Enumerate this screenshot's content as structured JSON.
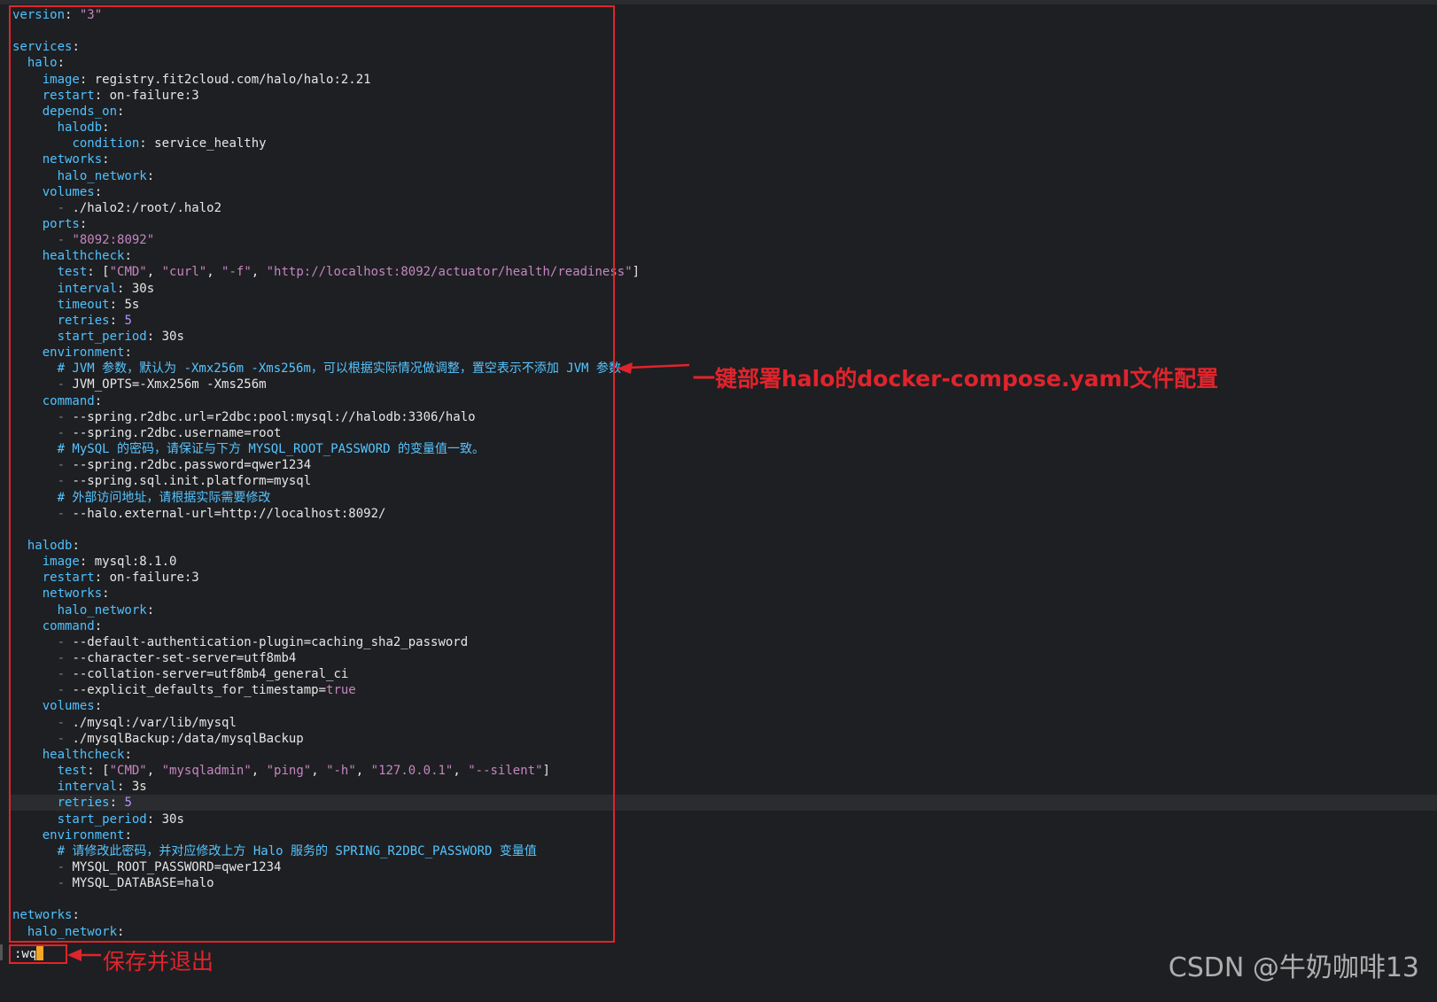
{
  "editor": {
    "lines": [
      [
        {
          "t": "version",
          "c": "k"
        },
        {
          "t": ": ",
          "c": "v"
        },
        {
          "t": "\"3\"",
          "c": "s"
        }
      ],
      [],
      [
        {
          "t": "services",
          "c": "k"
        },
        {
          "t": ":",
          "c": "v"
        }
      ],
      [
        {
          "t": "  "
        },
        {
          "t": "halo",
          "c": "k"
        },
        {
          "t": ":",
          "c": "v"
        }
      ],
      [
        {
          "t": "    "
        },
        {
          "t": "image",
          "c": "k"
        },
        {
          "t": ": registry.fit2cloud.com/halo/halo:2.21",
          "c": "v"
        }
      ],
      [
        {
          "t": "    "
        },
        {
          "t": "restart",
          "c": "k"
        },
        {
          "t": ": on-failure:3",
          "c": "v"
        }
      ],
      [
        {
          "t": "    "
        },
        {
          "t": "depends_on",
          "c": "k"
        },
        {
          "t": ":",
          "c": "v"
        }
      ],
      [
        {
          "t": "      "
        },
        {
          "t": "halodb",
          "c": "k"
        },
        {
          "t": ":",
          "c": "v"
        }
      ],
      [
        {
          "t": "        "
        },
        {
          "t": "condition",
          "c": "k"
        },
        {
          "t": ": service_healthy",
          "c": "v"
        }
      ],
      [
        {
          "t": "    "
        },
        {
          "t": "networks",
          "c": "k"
        },
        {
          "t": ":",
          "c": "v"
        }
      ],
      [
        {
          "t": "      "
        },
        {
          "t": "halo_network",
          "c": "k"
        },
        {
          "t": ":",
          "c": "v"
        }
      ],
      [
        {
          "t": "    "
        },
        {
          "t": "volumes",
          "c": "k"
        },
        {
          "t": ":",
          "c": "v"
        }
      ],
      [
        {
          "t": "      "
        },
        {
          "t": "- ",
          "c": "dash"
        },
        {
          "t": "./halo2:/root/.halo2",
          "c": "v"
        }
      ],
      [
        {
          "t": "    "
        },
        {
          "t": "ports",
          "c": "k"
        },
        {
          "t": ":",
          "c": "v"
        }
      ],
      [
        {
          "t": "      "
        },
        {
          "t": "- ",
          "c": "dash"
        },
        {
          "t": "\"8092:8092\"",
          "c": "s"
        }
      ],
      [
        {
          "t": "    "
        },
        {
          "t": "healthcheck",
          "c": "k"
        },
        {
          "t": ":",
          "c": "v"
        }
      ],
      [
        {
          "t": "      "
        },
        {
          "t": "test",
          "c": "k"
        },
        {
          "t": ": [",
          "c": "v"
        },
        {
          "t": "\"CMD\"",
          "c": "s"
        },
        {
          "t": ", ",
          "c": "v"
        },
        {
          "t": "\"curl\"",
          "c": "s"
        },
        {
          "t": ", ",
          "c": "v"
        },
        {
          "t": "\"-f\"",
          "c": "s"
        },
        {
          "t": ", ",
          "c": "v"
        },
        {
          "t": "\"http://localhost:8092/actuator/health/readiness\"",
          "c": "s"
        },
        {
          "t": "]",
          "c": "v"
        }
      ],
      [
        {
          "t": "      "
        },
        {
          "t": "interval",
          "c": "k"
        },
        {
          "t": ": 30s",
          "c": "v"
        }
      ],
      [
        {
          "t": "      "
        },
        {
          "t": "timeout",
          "c": "k"
        },
        {
          "t": ": 5s",
          "c": "v"
        }
      ],
      [
        {
          "t": "      "
        },
        {
          "t": "retries",
          "c": "k"
        },
        {
          "t": ": ",
          "c": "v"
        },
        {
          "t": "5",
          "c": "num"
        }
      ],
      [
        {
          "t": "      "
        },
        {
          "t": "start_period",
          "c": "k"
        },
        {
          "t": ": 30s",
          "c": "v"
        }
      ],
      [
        {
          "t": "    "
        },
        {
          "t": "environment",
          "c": "k"
        },
        {
          "t": ":",
          "c": "v"
        }
      ],
      [
        {
          "t": "      "
        },
        {
          "t": "# JVM 参数，默认为 -Xmx256m -Xms256m，可以根据实际情况做调整，置空表示不添加 JVM 参数",
          "c": "c"
        }
      ],
      [
        {
          "t": "      "
        },
        {
          "t": "- ",
          "c": "dash"
        },
        {
          "t": "JVM_OPTS=-Xmx256m -Xms256m",
          "c": "v"
        }
      ],
      [
        {
          "t": "    "
        },
        {
          "t": "command",
          "c": "k"
        },
        {
          "t": ":",
          "c": "v"
        }
      ],
      [
        {
          "t": "      "
        },
        {
          "t": "- ",
          "c": "dash"
        },
        {
          "t": "--spring.r2dbc.url=r2dbc:pool:mysql://halodb:3306/halo",
          "c": "v"
        }
      ],
      [
        {
          "t": "      "
        },
        {
          "t": "- ",
          "c": "dash"
        },
        {
          "t": "--spring.r2dbc.username=root",
          "c": "v"
        }
      ],
      [
        {
          "t": "      "
        },
        {
          "t": "# MySQL 的密码，请保证与下方 MYSQL_ROOT_PASSWORD 的变量值一致。",
          "c": "c"
        }
      ],
      [
        {
          "t": "      "
        },
        {
          "t": "- ",
          "c": "dash"
        },
        {
          "t": "--spring.r2dbc.password=qwer1234",
          "c": "v"
        }
      ],
      [
        {
          "t": "      "
        },
        {
          "t": "- ",
          "c": "dash"
        },
        {
          "t": "--spring.sql.init.platform=mysql",
          "c": "v"
        }
      ],
      [
        {
          "t": "      "
        },
        {
          "t": "# 外部访问地址，请根据实际需要修改",
          "c": "c"
        }
      ],
      [
        {
          "t": "      "
        },
        {
          "t": "- ",
          "c": "dash"
        },
        {
          "t": "--halo.external-url=http://localhost:8092/",
          "c": "v"
        }
      ],
      [],
      [
        {
          "t": "  "
        },
        {
          "t": "halodb",
          "c": "k"
        },
        {
          "t": ":",
          "c": "v"
        }
      ],
      [
        {
          "t": "    "
        },
        {
          "t": "image",
          "c": "k"
        },
        {
          "t": ": mysql:8.1.0",
          "c": "v"
        }
      ],
      [
        {
          "t": "    "
        },
        {
          "t": "restart",
          "c": "k"
        },
        {
          "t": ": on-failure:3",
          "c": "v"
        }
      ],
      [
        {
          "t": "    "
        },
        {
          "t": "networks",
          "c": "k"
        },
        {
          "t": ":",
          "c": "v"
        }
      ],
      [
        {
          "t": "      "
        },
        {
          "t": "halo_network",
          "c": "k"
        },
        {
          "t": ":",
          "c": "v"
        }
      ],
      [
        {
          "t": "    "
        },
        {
          "t": "command",
          "c": "k"
        },
        {
          "t": ":",
          "c": "v"
        }
      ],
      [
        {
          "t": "      "
        },
        {
          "t": "- ",
          "c": "dash"
        },
        {
          "t": "--default-authentication-plugin=caching_sha2_password",
          "c": "v"
        }
      ],
      [
        {
          "t": "      "
        },
        {
          "t": "- ",
          "c": "dash"
        },
        {
          "t": "--character-set-server=utf8mb4",
          "c": "v"
        }
      ],
      [
        {
          "t": "      "
        },
        {
          "t": "- ",
          "c": "dash"
        },
        {
          "t": "--collation-server=utf8mb4_general_ci",
          "c": "v"
        }
      ],
      [
        {
          "t": "      "
        },
        {
          "t": "- ",
          "c": "dash"
        },
        {
          "t": "--explicit_defaults_for_timestamp=",
          "c": "v"
        },
        {
          "t": "true",
          "c": "s"
        }
      ],
      [
        {
          "t": "    "
        },
        {
          "t": "volumes",
          "c": "k"
        },
        {
          "t": ":",
          "c": "v"
        }
      ],
      [
        {
          "t": "      "
        },
        {
          "t": "- ",
          "c": "dash"
        },
        {
          "t": "./mysql:/var/lib/mysql",
          "c": "v"
        }
      ],
      [
        {
          "t": "      "
        },
        {
          "t": "- ",
          "c": "dash"
        },
        {
          "t": "./mysqlBackup:/data/mysqlBackup",
          "c": "v"
        }
      ],
      [
        {
          "t": "    "
        },
        {
          "t": "healthcheck",
          "c": "k"
        },
        {
          "t": ":",
          "c": "v"
        }
      ],
      [
        {
          "t": "      "
        },
        {
          "t": "test",
          "c": "k"
        },
        {
          "t": ": [",
          "c": "v"
        },
        {
          "t": "\"CMD\"",
          "c": "s"
        },
        {
          "t": ", ",
          "c": "v"
        },
        {
          "t": "\"mysqladmin\"",
          "c": "s"
        },
        {
          "t": ", ",
          "c": "v"
        },
        {
          "t": "\"ping\"",
          "c": "s"
        },
        {
          "t": ", ",
          "c": "v"
        },
        {
          "t": "\"-h\"",
          "c": "s"
        },
        {
          "t": ", ",
          "c": "v"
        },
        {
          "t": "\"127.0.0.1\"",
          "c": "s"
        },
        {
          "t": ", ",
          "c": "v"
        },
        {
          "t": "\"--silent\"",
          "c": "s"
        },
        {
          "t": "]",
          "c": "v"
        }
      ],
      [
        {
          "t": "      "
        },
        {
          "t": "interval",
          "c": "k"
        },
        {
          "t": ": 3s",
          "c": "v"
        }
      ],
      [
        {
          "t": "      "
        },
        {
          "t": "retries",
          "c": "k"
        },
        {
          "t": ": ",
          "c": "v"
        },
        {
          "t": "5",
          "c": "num"
        }
      ],
      [
        {
          "t": "      "
        },
        {
          "t": "start_period",
          "c": "k"
        },
        {
          "t": ": 30s",
          "c": "v"
        }
      ],
      [
        {
          "t": "    "
        },
        {
          "t": "environment",
          "c": "k"
        },
        {
          "t": ":",
          "c": "v"
        }
      ],
      [
        {
          "t": "      "
        },
        {
          "t": "# 请修改此密码，并对应修改上方 Halo 服务的 SPRING_R2DBC_PASSWORD 变量值",
          "c": "c"
        }
      ],
      [
        {
          "t": "      "
        },
        {
          "t": "- ",
          "c": "dash"
        },
        {
          "t": "MYSQL_ROOT_PASSWORD=qwer1234",
          "c": "v"
        }
      ],
      [
        {
          "t": "      "
        },
        {
          "t": "- ",
          "c": "dash"
        },
        {
          "t": "MYSQL_DATABASE=halo",
          "c": "v"
        }
      ],
      [],
      [
        {
          "t": "networks",
          "c": "k"
        },
        {
          "t": ":",
          "c": "v"
        }
      ],
      [
        {
          "t": "  "
        },
        {
          "t": "halo_network",
          "c": "k"
        },
        {
          "t": ":",
          "c": "v"
        }
      ]
    ],
    "current_line_index": 49
  },
  "command_line": {
    "text": ":wq"
  },
  "annotations": {
    "main_label": "一键部署halo的docker-compose.yaml文件配置",
    "save_label": "保存并退出"
  },
  "watermark": "CSDN @牛奶咖啡13",
  "colors": {
    "annotation": "#e0242c",
    "cursor": "#f5a623",
    "key": "#4fc1ff",
    "string": "#c586c0"
  }
}
